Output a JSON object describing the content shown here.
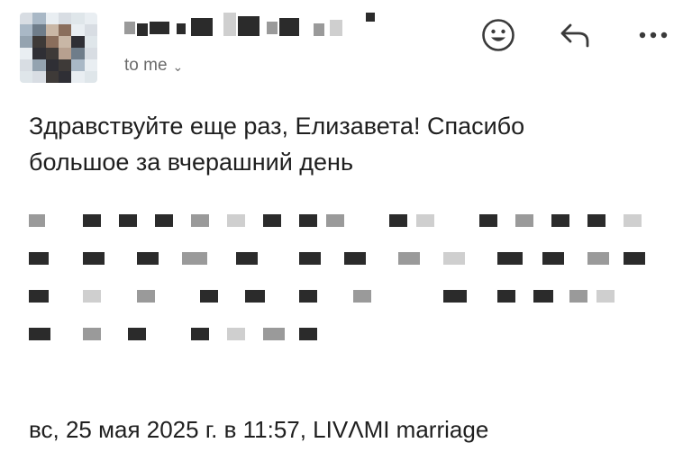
{
  "header": {
    "recipient_label": "to me",
    "chevron_glyph": "⌄",
    "emoji_action_icon": "smiley-icon",
    "reply_action_icon": "reply-icon",
    "more_action_icon": "more-icon"
  },
  "message": {
    "greeting_line1": "Здравствуйте еще раз, Елизавета! Спасибо",
    "greeting_line2": "большое за вчерашний день",
    "quote_header": "вс, 25 мая 2025 г. в 11:57, LIVΛMI marriage"
  },
  "colors": {
    "text": "#1f1f1f",
    "secondary_text": "#6b6b6b",
    "background": "#ffffff"
  }
}
